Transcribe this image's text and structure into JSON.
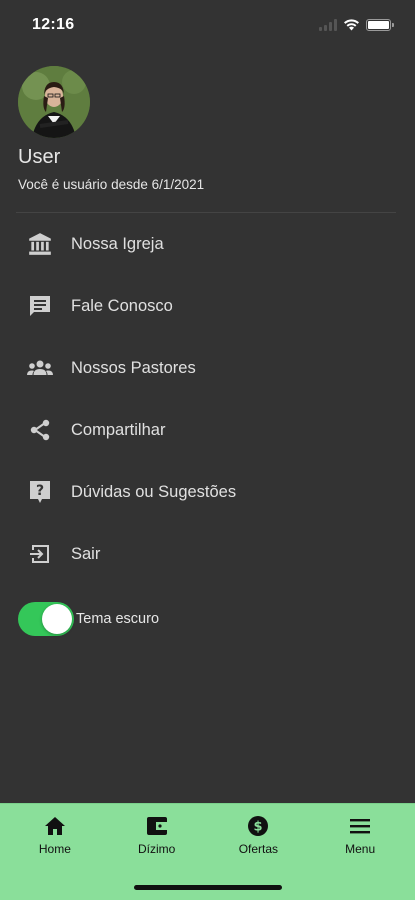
{
  "status_bar": {
    "time": "12:16"
  },
  "profile": {
    "name": "User",
    "member_since": "Você é usuário desde 6/1/2021"
  },
  "menu": {
    "items": [
      {
        "label": "Nossa Igreja",
        "icon": "bank-icon"
      },
      {
        "label": "Fale Conosco",
        "icon": "chat-icon"
      },
      {
        "label": "Nossos Pastores",
        "icon": "people-icon"
      },
      {
        "label": "Compartilhar",
        "icon": "share-icon"
      },
      {
        "label": "Dúvidas ou Sugestões",
        "icon": "help-icon"
      },
      {
        "label": "Sair",
        "icon": "logout-icon"
      }
    ]
  },
  "theme": {
    "label": "Tema escuro",
    "enabled": true
  },
  "tab_bar": {
    "tabs": [
      {
        "label": "Home",
        "icon": "home-icon"
      },
      {
        "label": "Dízimo",
        "icon": "wallet-icon"
      },
      {
        "label": "Ofertas",
        "icon": "dollar-icon"
      },
      {
        "label": "Menu",
        "icon": "menu-icon"
      }
    ]
  },
  "colors": {
    "background": "#333333",
    "tab_bar": "#8adf9a",
    "toggle_on": "#34c759"
  }
}
